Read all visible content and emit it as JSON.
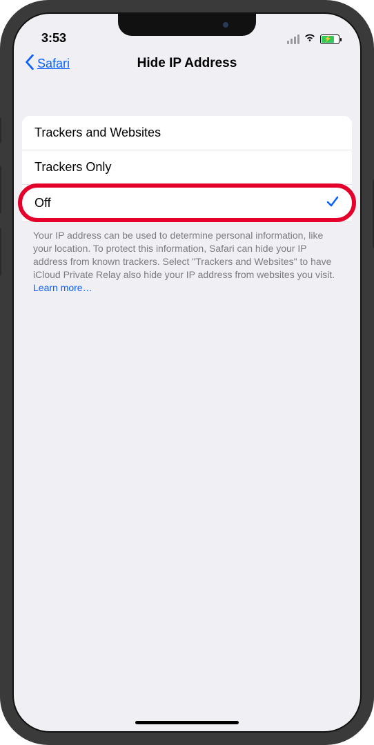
{
  "status": {
    "time": "3:53"
  },
  "nav": {
    "back_label": "Safari",
    "title": "Hide IP Address"
  },
  "options": [
    {
      "label": "Trackers and Websites",
      "selected": false
    },
    {
      "label": "Trackers Only",
      "selected": false
    },
    {
      "label": "Off",
      "selected": true
    }
  ],
  "footer": {
    "text": "Your IP address can be used to determine personal information, like your location. To protect this information, Safari can hide your IP address from known trackers. Select \"Trackers and Websites\" to have iCloud Private Relay also hide your IP address from websites you visit. ",
    "learn_more": "Learn more…"
  }
}
